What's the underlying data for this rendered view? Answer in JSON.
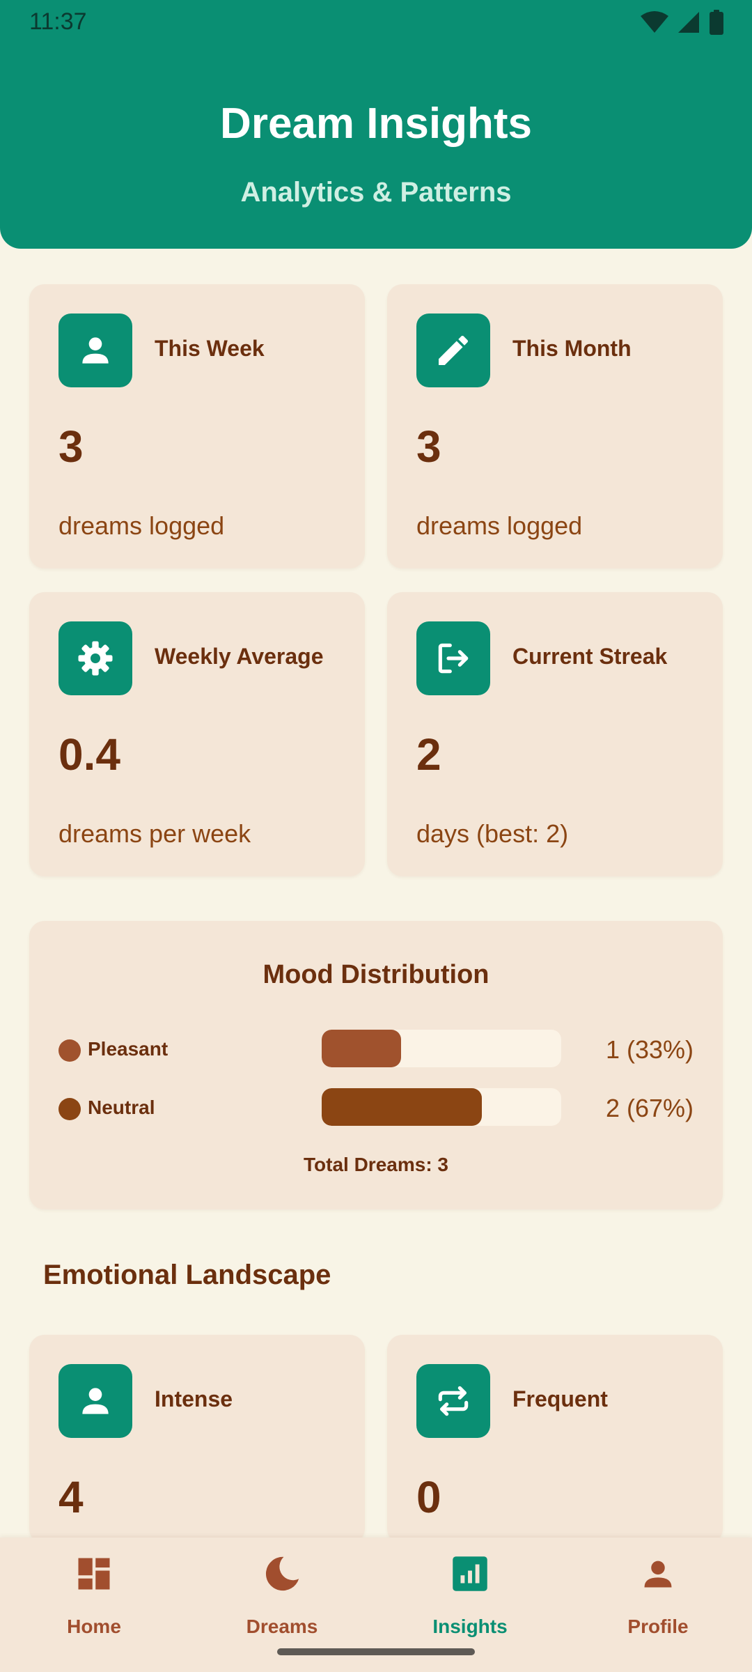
{
  "status_bar": {
    "time": "11:37"
  },
  "header": {
    "title": "Dream Insights",
    "subtitle": "Analytics & Patterns"
  },
  "stats": [
    {
      "icon": "person-icon",
      "label": "This Week",
      "value": "3",
      "sub": "dreams logged"
    },
    {
      "icon": "pencil-icon",
      "label": "This Month",
      "value": "3",
      "sub": "dreams logged"
    },
    {
      "icon": "gear-icon",
      "label": "Weekly Average",
      "value": "0.4",
      "sub": "dreams per week"
    },
    {
      "icon": "exit-icon",
      "label": "Current Streak",
      "value": "2",
      "sub": "days (best: 2)"
    }
  ],
  "mood": {
    "title": "Mood Distribution",
    "rows": [
      {
        "name": "Pleasant",
        "count": "1 (33%)",
        "fraction": 0.33,
        "color": "#A0522D"
      },
      {
        "name": "Neutral",
        "count": "2 (67%)",
        "fraction": 0.67,
        "color": "#8B4513"
      }
    ],
    "total": "Total Dreams: 3"
  },
  "emotional": {
    "title": "Emotional Landscape",
    "cards": [
      {
        "icon": "person-icon",
        "label": "Intense",
        "value": "4"
      },
      {
        "icon": "repeat-icon",
        "label": "Frequent",
        "value": "0"
      }
    ]
  },
  "nav": {
    "items": [
      {
        "icon": "dashboard-icon",
        "label": "Home"
      },
      {
        "icon": "moon-icon",
        "label": "Dreams"
      },
      {
        "icon": "insights-icon",
        "label": "Insights",
        "active": true
      },
      {
        "icon": "profile-icon",
        "label": "Profile"
      }
    ]
  },
  "colors": {
    "primary": "#0A8F73",
    "brown": "#6B2F0E",
    "card": "#F4E6D7",
    "background": "#F8F4E6"
  }
}
